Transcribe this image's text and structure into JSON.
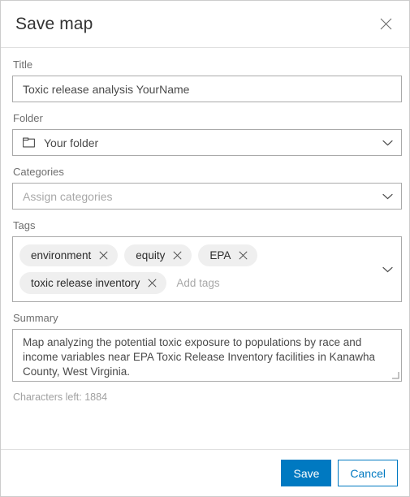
{
  "dialog": {
    "title": "Save map",
    "close_icon": "close-icon"
  },
  "form": {
    "title_field": {
      "label": "Title",
      "value": "Toxic release analysis YourName",
      "placeholder": "Title"
    },
    "folder_field": {
      "label": "Folder",
      "value": "Your folder",
      "icon": "folder-icon",
      "chevron": "chevron-down-icon"
    },
    "categories_field": {
      "label": "Categories",
      "value": "",
      "placeholder": "Assign categories",
      "chevron": "chevron-down-icon"
    },
    "tags_field": {
      "label": "Tags",
      "tags": [
        "environment",
        "equity",
        "EPA",
        "toxic release inventory"
      ],
      "placeholder": "Add tags",
      "remove_icon": "close-icon",
      "chevron": "chevron-down-icon"
    },
    "summary_field": {
      "label": "Summary",
      "value": "Map analyzing the potential toxic exposure to populations by race and income variables near EPA Toxic Release Inventory facilities in Kanawha County, West Virginia.",
      "characters_left": "Characters left: 1884"
    }
  },
  "footer": {
    "save_label": "Save",
    "cancel_label": "Cancel"
  },
  "colors": {
    "accent": "#0079c1",
    "border": "#aaaaaa",
    "chip_bg": "#efefef",
    "label_text": "#6e6e6e",
    "placeholder_text": "#a8a8a8"
  }
}
